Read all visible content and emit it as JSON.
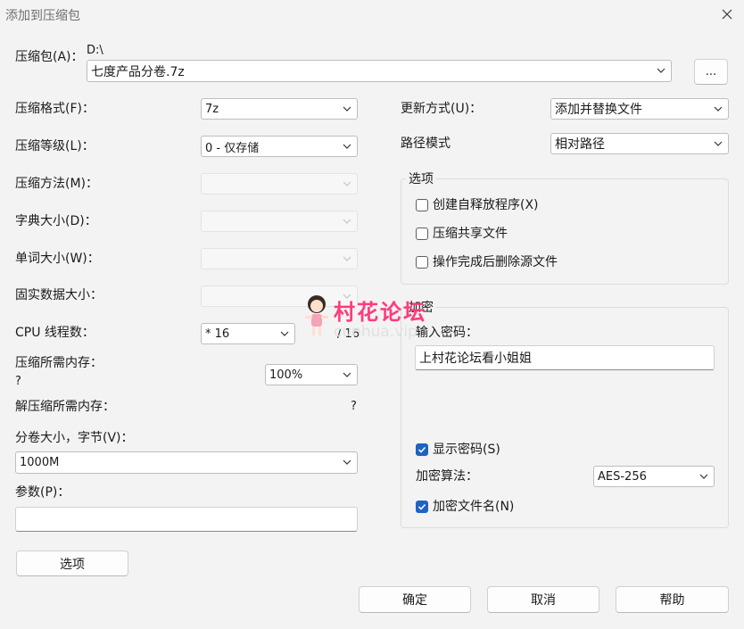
{
  "window": {
    "title": "添加到压缩包",
    "close_glyph": "✕"
  },
  "archive": {
    "label": "压缩包(A)：",
    "path": "D:\\",
    "name": "七度产品分卷.7z",
    "browse_label": "..."
  },
  "left": {
    "format_label": "压缩格式(F)：",
    "format_value": "7z",
    "level_label": "压缩等级(L)：",
    "level_value": "0 - 仅存储",
    "method_label": "压缩方法(M)：",
    "method_value": "",
    "dict_label": "字典大小(D)：",
    "dict_value": "",
    "word_label": "单词大小(W)：",
    "word_value": "",
    "solid_label": "固实数据大小：",
    "solid_value": "",
    "cpu_label": "CPU 线程数：",
    "cpu_value": "* 16",
    "cpu_max": "/ 16",
    "mem_comp_label": "压缩所需内存：",
    "mem_comp_value": "?",
    "mem_percent_value": "100%",
    "mem_decomp_label": "解压缩所需内存：",
    "mem_decomp_value": "?",
    "volume_label": "分卷大小，字节(V)：",
    "volume_value": "1000M",
    "params_label": "参数(P)：",
    "params_value": "",
    "options_button": "选项"
  },
  "right": {
    "update_label": "更新方式(U)：",
    "update_value": "添加并替换文件",
    "path_mode_label": "路径模式",
    "path_mode_value": "相对路径",
    "options_group": {
      "title": "选项",
      "sfx": "创建自释放程序(X)",
      "shared": "压缩共享文件",
      "delete_after": "操作完成后删除源文件"
    },
    "encryption_group": {
      "title": "加密",
      "password_label": "输入密码：",
      "password_value": "上村花论坛看小姐姐",
      "show_password": "显示密码(S)",
      "method_label": "加密算法：",
      "method_value": "AES-256",
      "encrypt_names": "加密文件名(N)"
    }
  },
  "states": {
    "sfx_checked": false,
    "shared_checked": false,
    "delete_checked": false,
    "show_password_checked": true,
    "encrypt_names_checked": true
  },
  "footer": {
    "ok": "确定",
    "cancel": "取消",
    "help": "帮助"
  },
  "watermark": {
    "text": "村花论坛",
    "sub": "cunhua.vip"
  },
  "colors": {
    "accent": "#1f63c2",
    "watermark": "#ff3b7d",
    "background": "#f3f3f3"
  }
}
